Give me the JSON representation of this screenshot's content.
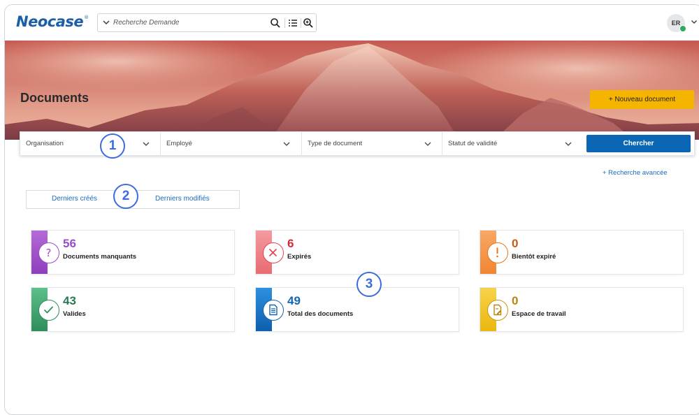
{
  "brand": {
    "name": "Neocase",
    "mark": "®"
  },
  "header": {
    "search_placeholder": "Recherche Demande",
    "icons": [
      "chevron-down-icon",
      "search-icon",
      "list-icon",
      "zoom-in-icon"
    ],
    "user_initials": "ER",
    "user_status_color": "#2eaa5c"
  },
  "page": {
    "title": "Documents",
    "new_document_label": "+ Nouveau document"
  },
  "filters": {
    "items": [
      {
        "label": "Organisation"
      },
      {
        "label": "Employé"
      },
      {
        "label": "Type de document"
      },
      {
        "label": "Statut de validité"
      }
    ],
    "search_label": "Chercher",
    "advanced_label": "+ Recherche avancée"
  },
  "tabs": [
    {
      "label": "Derniers créés"
    },
    {
      "label": "Derniers modifiés"
    }
  ],
  "cards": [
    {
      "value": "56",
      "label": "Documents manquants",
      "color": "#9b4cc7",
      "icon": "question-icon"
    },
    {
      "value": "6",
      "label": "Expirés",
      "color": "#d02b3b",
      "icon": "close-icon"
    },
    {
      "value": "0",
      "label": "Bientôt expiré",
      "color": "#c55c13",
      "icon": "exclamation-icon"
    },
    {
      "value": "43",
      "label": "Valides",
      "color": "#2a7a4f",
      "icon": "check-icon"
    },
    {
      "value": "49",
      "label": "Total des documents",
      "color": "#1466b3",
      "icon": "document-icon"
    },
    {
      "value": "0",
      "label": "Espace de travail",
      "color": "#b8860b",
      "icon": "edit-document-icon"
    }
  ],
  "markers": [
    "1",
    "2",
    "3"
  ],
  "colors": {
    "primary": "#0b66b5",
    "accent": "#f5b400",
    "link": "#1a6bbd",
    "marker": "#3d6be0"
  }
}
